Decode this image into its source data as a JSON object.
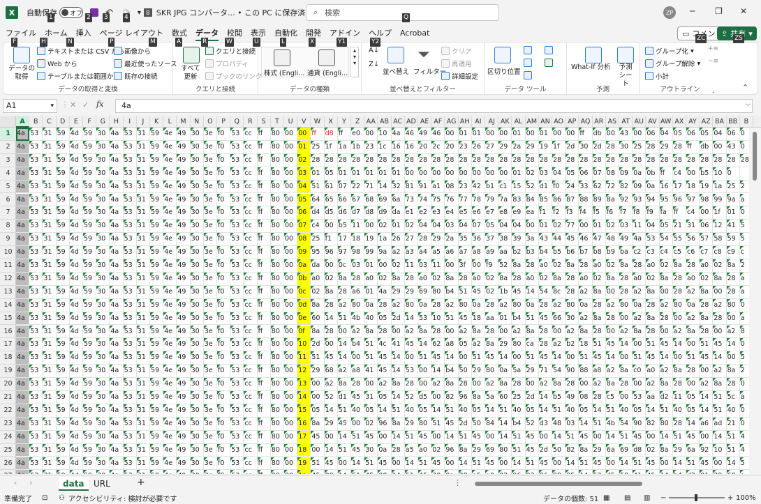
{
  "title_bar": {
    "autosave_label": "自動保存",
    "autosave_state": "オフ",
    "doc_title": "SKR JPG コンバータ... • この PC に保存済み",
    "search_placeholder": "検索",
    "avatar_label": "ZP",
    "keytips": [
      "1",
      "2",
      "3",
      "4",
      "Q"
    ]
  },
  "tabs": [
    {
      "label": "ファイル",
      "key": "F"
    },
    {
      "label": "ホーム",
      "key": "H"
    },
    {
      "label": "挿入",
      "key": "N"
    },
    {
      "label": "ページ レイアウト",
      "key": "P"
    },
    {
      "label": "数式",
      "key": "M"
    },
    {
      "label": "データ",
      "key": "A"
    },
    {
      "label": "校閲",
      "key": "R"
    },
    {
      "label": "表示",
      "key": "W"
    },
    {
      "label": "自動化",
      "key": "U"
    },
    {
      "label": "開発",
      "key": "L"
    },
    {
      "label": "アドイン",
      "key": "X"
    },
    {
      "label": "ヘルプ",
      "key": "Y1"
    },
    {
      "label": "Acrobat",
      "key": "Y2"
    }
  ],
  "comment_button": {
    "label": "コメント",
    "key": "ZC"
  },
  "share_button": {
    "label": "共有",
    "key": "ZS"
  },
  "ribbon": {
    "get_data": {
      "title": "データの取得",
      "items": [
        "テキストまたは CSV から",
        "Web から",
        "テーブルまたは範囲から",
        "画像から",
        "最近使ったソース",
        "既存の接続"
      ],
      "label": "データの取得と変換"
    },
    "queries": {
      "refresh": "すべて更新",
      "items": [
        "クエリと接続",
        "プロパティ",
        "ブックのリンク"
      ],
      "label": "クエリと接続"
    },
    "types": {
      "items": [
        "株式 (Engli...",
        "通貨 (Engli..."
      ],
      "label": "データの種類"
    },
    "sort": {
      "items": [
        "並べ替え",
        "フィルター",
        "クリア",
        "再適用",
        "詳細設定"
      ],
      "label": "並べ替えとフィルター"
    },
    "tools": {
      "items": [
        "区切り位置"
      ],
      "label": "データ ツール"
    },
    "forecast": {
      "items": [
        "What-If 分析",
        "予測シート"
      ],
      "label": "予測"
    },
    "outline": {
      "items": [
        "グループ化",
        "グループ解除",
        "小計"
      ],
      "label": "アウトライン"
    }
  },
  "formula_bar": {
    "cell_ref": "A1",
    "fx": "fx",
    "value": "4a"
  },
  "columns": [
    "A",
    "B",
    "C",
    "D",
    "E",
    "F",
    "G",
    "H",
    "I",
    "J",
    "K",
    "L",
    "M",
    "N",
    "O",
    "P",
    "Q",
    "R",
    "S",
    "T",
    "U",
    "V",
    "W",
    "X",
    "Y",
    "Z",
    "AA",
    "AB",
    "AC",
    "AD",
    "AE",
    "AF",
    "AG",
    "AH",
    "AI",
    "AJ",
    "AK",
    "AL",
    "AM",
    "AN",
    "AO",
    "AP",
    "AQ",
    "AR",
    "AS",
    "AT",
    "AU",
    "AV",
    "AW",
    "AX",
    "AY",
    "AZ",
    "BA",
    "BB",
    "B"
  ],
  "common_prefix": [
    "4a",
    "53",
    "31",
    "59",
    "4d",
    "59",
    "30",
    "4a",
    "53",
    "31",
    "59",
    "4e",
    "49",
    "30",
    "3e",
    "f0",
    "53",
    "cc",
    "ff",
    "80",
    "00"
  ],
  "rows": [
    {
      "num": "1",
      "v": "00",
      "tail": [
        "ff",
        "d8",
        "ff",
        "e0",
        "00",
        "10",
        "4a",
        "46",
        "49",
        "46",
        "00",
        "01",
        "01",
        "00",
        "00",
        "01",
        "00",
        "01",
        "00",
        "00",
        "ff",
        "db",
        "00",
        "43",
        "00",
        "06",
        "04",
        "05",
        "06",
        "05",
        "04",
        "06",
        "0"
      ]
    },
    {
      "num": "2",
      "v": "01",
      "tail": [
        "25",
        "1f",
        "1a",
        "1b",
        "23",
        "1c",
        "16",
        "16",
        "20",
        "2c",
        "20",
        "23",
        "26",
        "27",
        "29",
        "2a",
        "29",
        "19",
        "1f",
        "2d",
        "30",
        "2d",
        "28",
        "30",
        "25",
        "28",
        "29",
        "28",
        "ff",
        "db",
        "00",
        "43",
        "0"
      ]
    },
    {
      "num": "3",
      "v": "02",
      "tail": [
        "28",
        "28",
        "28",
        "28",
        "28",
        "28",
        "28",
        "28",
        "28",
        "28",
        "28",
        "28",
        "28",
        "28",
        "28",
        "28",
        "28",
        "28",
        "28",
        "28",
        "28",
        "28",
        "28",
        "28",
        "28",
        "28",
        "28",
        "28",
        "28",
        "28",
        "28",
        "28",
        "28"
      ]
    },
    {
      "num": "4",
      "v": "03",
      "tail": [
        "01",
        "05",
        "01",
        "01",
        "01",
        "01",
        "01",
        "00",
        "00",
        "00",
        "00",
        "00",
        "00",
        "00",
        "00",
        "01",
        "02",
        "03",
        "04",
        "05",
        "06",
        "07",
        "08",
        "09",
        "0a",
        "0b",
        "ff",
        "c4",
        "00",
        "b5",
        "10",
        "0",
        ""
      ]
    },
    {
      "num": "5",
      "v": "04",
      "tail": [
        "51",
        "61",
        "07",
        "22",
        "71",
        "14",
        "32",
        "81",
        "91",
        "a1",
        "08",
        "23",
        "42",
        "b1",
        "c1",
        "15",
        "52",
        "d1",
        "f0",
        "24",
        "33",
        "62",
        "72",
        "82",
        "09",
        "0a",
        "16",
        "17",
        "18",
        "19",
        "1a",
        "25",
        "2"
      ]
    },
    {
      "num": "6",
      "v": "05",
      "tail": [
        "64",
        "65",
        "66",
        "67",
        "68",
        "69",
        "6a",
        "73",
        "74",
        "75",
        "76",
        "77",
        "78",
        "79",
        "7a",
        "83",
        "84",
        "85",
        "86",
        "87",
        "88",
        "89",
        "8a",
        "92",
        "93",
        "94",
        "95",
        "96",
        "97",
        "98",
        "99",
        "9a",
        "a"
      ]
    },
    {
      "num": "7",
      "v": "06",
      "tail": [
        "d4",
        "d5",
        "d6",
        "d7",
        "d8",
        "d9",
        "da",
        "e1",
        "e2",
        "e3",
        "e4",
        "e5",
        "e6",
        "e7",
        "e8",
        "e9",
        "ea",
        "f1",
        "f2",
        "f3",
        "f4",
        "f5",
        "f6",
        "f7",
        "f8",
        "f9",
        "fa",
        "ff",
        "c4",
        "00",
        "1f",
        "01",
        "0"
      ]
    },
    {
      "num": "8",
      "v": "07",
      "tail": [
        "c4",
        "00",
        "b5",
        "11",
        "00",
        "02",
        "01",
        "02",
        "04",
        "04",
        "03",
        "04",
        "07",
        "05",
        "04",
        "04",
        "00",
        "01",
        "02",
        "77",
        "00",
        "01",
        "02",
        "03",
        "11",
        "04",
        "05",
        "21",
        "31",
        "06",
        "12",
        "41",
        "5"
      ]
    },
    {
      "num": "9",
      "v": "08",
      "tail": [
        "25",
        "f1",
        "17",
        "18",
        "19",
        "1a",
        "26",
        "27",
        "28",
        "29",
        "2a",
        "35",
        "36",
        "37",
        "38",
        "39",
        "3a",
        "43",
        "44",
        "45",
        "46",
        "47",
        "48",
        "49",
        "4a",
        "53",
        "54",
        "55",
        "56",
        "57",
        "58",
        "59",
        "5"
      ]
    },
    {
      "num": "10",
      "v": "09",
      "tail": [
        "95",
        "96",
        "97",
        "98",
        "99",
        "9a",
        "a2",
        "a3",
        "a4",
        "a5",
        "a6",
        "a7",
        "a8",
        "a9",
        "aa",
        "b2",
        "b3",
        "b4",
        "b5",
        "b6",
        "b7",
        "b8",
        "b9",
        "ba",
        "c2",
        "c3",
        "c4",
        "c5",
        "c6",
        "c7",
        "c8",
        "c9",
        "c"
      ]
    },
    {
      "num": "11",
      "v": "0a",
      "tail": [
        "da",
        "00",
        "0c",
        "03",
        "01",
        "00",
        "02",
        "11",
        "03",
        "11",
        "00",
        "3f",
        "00",
        "f9",
        "52",
        "8a",
        "28",
        "a0",
        "02",
        "8a",
        "28",
        "a0",
        "02",
        "8a",
        "28",
        "a0",
        "02",
        "8a",
        "28",
        "a0",
        "02",
        "8a",
        "2"
      ]
    },
    {
      "num": "12",
      "v": "0b",
      "tail": [
        "a0",
        "02",
        "8a",
        "28",
        "a0",
        "02",
        "8a",
        "28",
        "a0",
        "02",
        "8a",
        "28",
        "a0",
        "02",
        "8a",
        "28",
        "a0",
        "02",
        "8a",
        "28",
        "a0",
        "02",
        "8a",
        "28",
        "a0",
        "02",
        "8a",
        "28",
        "a0",
        "02",
        "8a",
        "28",
        "a"
      ]
    },
    {
      "num": "13",
      "v": "0c",
      "tail": [
        "02",
        "8a",
        "28",
        "a6",
        "01",
        "4a",
        "29",
        "29",
        "69",
        "80",
        "b4",
        "51",
        "45",
        "02",
        "1b",
        "45",
        "14",
        "54",
        "8c",
        "28",
        "a2",
        "8a",
        "00",
        "28",
        "a2",
        "8a",
        "00",
        "28",
        "a2",
        "8a",
        "00",
        "28",
        "a"
      ]
    },
    {
      "num": "14",
      "v": "0d",
      "tail": [
        "8a",
        "28",
        "a2",
        "80",
        "0a",
        "28",
        "a2",
        "80",
        "0a",
        "28",
        "a2",
        "80",
        "0a",
        "28",
        "a2",
        "80",
        "0a",
        "28",
        "a2",
        "80",
        "0a",
        "28",
        "a2",
        "80",
        "0a",
        "28",
        "a2",
        "80",
        "0a",
        "28",
        "a2",
        "80",
        "0"
      ]
    },
    {
      "num": "15",
      "v": "0e",
      "tail": [
        "60",
        "14",
        "51",
        "4b",
        "40",
        "05",
        "2d",
        "14",
        "53",
        "10",
        "51",
        "45",
        "18",
        "aa",
        "01",
        "b4",
        "51",
        "45",
        "66",
        "30",
        "a2",
        "8a",
        "28",
        "00",
        "a2",
        "8a",
        "28",
        "00",
        "a2",
        "8a",
        "28",
        "00",
        "a"
      ]
    },
    {
      "num": "16",
      "v": "0f",
      "tail": [
        "8a",
        "28",
        "00",
        "a2",
        "8a",
        "28",
        "00",
        "a2",
        "8a",
        "28",
        "00",
        "a2",
        "8a",
        "28",
        "00",
        "a2",
        "8a",
        "28",
        "00",
        "a2",
        "8a",
        "28",
        "00",
        "a2",
        "8a",
        "28",
        "00",
        "a2",
        "8a",
        "28",
        "00",
        "a2",
        "8"
      ]
    },
    {
      "num": "17",
      "v": "10",
      "tail": [
        "2d",
        "00",
        "14",
        "b4",
        "51",
        "4c",
        "41",
        "45",
        "14",
        "62",
        "a8",
        "05",
        "a2",
        "8a",
        "29",
        "80",
        "ca",
        "28",
        "a2",
        "b2",
        "18",
        "51",
        "45",
        "14",
        "00",
        "51",
        "45",
        "14",
        "00",
        "51",
        "45",
        "14",
        "0"
      ]
    },
    {
      "num": "18",
      "v": "11",
      "tail": [
        "51",
        "45",
        "14",
        "00",
        "51",
        "45",
        "14",
        "00",
        "51",
        "45",
        "14",
        "00",
        "51",
        "45",
        "14",
        "00",
        "51",
        "45",
        "14",
        "00",
        "51",
        "45",
        "14",
        "00",
        "51",
        "45",
        "14",
        "00",
        "51",
        "45",
        "14",
        "00",
        "5"
      ]
    },
    {
      "num": "19",
      "v": "12",
      "tail": [
        "29",
        "68",
        "a2",
        "a8",
        "41",
        "45",
        "14",
        "53",
        "00",
        "14",
        "b4",
        "50",
        "29",
        "80",
        "0a",
        "5a",
        "29",
        "71",
        "54",
        "90",
        "88",
        "a8",
        "a2",
        "8a",
        "c0",
        "a0",
        "a2",
        "8a",
        "28",
        "00",
        "a2",
        "8a",
        "2"
      ]
    },
    {
      "num": "20",
      "v": "13",
      "tail": [
        "00",
        "a2",
        "8a",
        "28",
        "00",
        "a2",
        "8a",
        "28",
        "00",
        "a2",
        "8a",
        "28",
        "00",
        "a2",
        "8a",
        "28",
        "00",
        "a2",
        "8a",
        "28",
        "00",
        "a2",
        "8a",
        "28",
        "00",
        "a2",
        "8a",
        "28",
        "00",
        "a2",
        "8a",
        "28",
        "0"
      ]
    },
    {
      "num": "21",
      "v": "14",
      "tail": [
        "00",
        "52",
        "d1",
        "45",
        "31",
        "05",
        "14",
        "52",
        "d5",
        "00",
        "82",
        "96",
        "8a",
        "5a",
        "60",
        "25",
        "2d",
        "14",
        "b5",
        "49",
        "08",
        "28",
        "c5",
        "00",
        "53",
        "aa",
        "d2",
        "11",
        "05",
        "14",
        "51",
        "5c",
        "a"
      ]
    },
    {
      "num": "22",
      "v": "15",
      "tail": [
        "05",
        "14",
        "51",
        "40",
        "05",
        "14",
        "51",
        "40",
        "05",
        "14",
        "51",
        "40",
        "05",
        "14",
        "51",
        "40",
        "05",
        "14",
        "51",
        "40",
        "05",
        "14",
        "51",
        "40",
        "05",
        "14",
        "51",
        "40",
        "05",
        "14",
        "51",
        "40",
        "0"
      ]
    },
    {
      "num": "23",
      "v": "16",
      "tail": [
        "8a",
        "29",
        "45",
        "00",
        "02",
        "96",
        "8a",
        "29",
        "80",
        "51",
        "45",
        "2d",
        "50",
        "84",
        "14",
        "b4",
        "52",
        "d3",
        "48",
        "03",
        "14",
        "51",
        "4b",
        "54",
        "90",
        "82",
        "80",
        "28",
        "14",
        "a6",
        "ad",
        "21",
        "0"
      ]
    },
    {
      "num": "24",
      "v": "17",
      "tail": [
        "45",
        "00",
        "14",
        "51",
        "45",
        "00",
        "14",
        "51",
        "45",
        "00",
        "14",
        "51",
        "45",
        "00",
        "14",
        "51",
        "45",
        "00",
        "14",
        "51",
        "45",
        "00",
        "14",
        "51",
        "45",
        "00",
        "14",
        "51",
        "45",
        "00",
        "14",
        "51",
        "4"
      ]
    },
    {
      "num": "25",
      "v": "18",
      "tail": [
        "00",
        "14",
        "51",
        "45",
        "30",
        "0a",
        "28",
        "a5",
        "a0",
        "02",
        "96",
        "8a",
        "29",
        "69",
        "80",
        "51",
        "45",
        "2d",
        "50",
        "82",
        "8a",
        "29",
        "6a",
        "69",
        "d8",
        "02",
        "8a",
        "29",
        "6a",
        "92",
        "10",
        "51",
        "4"
      ]
    },
    {
      "num": "26",
      "v": "19",
      "tail": [
        "51",
        "45",
        "00",
        "14",
        "51",
        "45",
        "00",
        "14",
        "51",
        "45",
        "00",
        "14",
        "51",
        "45",
        "00",
        "14",
        "51",
        "45",
        "00",
        "14",
        "51",
        "45",
        "00",
        "14",
        "51",
        "45",
        "00",
        "14",
        "51",
        "45",
        "00",
        "14",
        "5"
      ]
    },
    {
      "num": "27",
      "v": "1a",
      "tail": [
        "45",
        "00",
        "14",
        "51",
        "45",
        "00",
        "14",
        "51",
        "45",
        "30",
        "0a",
        "28",
        "a5",
        "a0",
        "02",
        "96",
        "92",
        "96",
        "98",
        "05",
        "14",
        "52",
        "d5",
        "58",
        "41",
        "45",
        "14",
        "b4",
        "d2",
        "01",
        "29",
        "68",
        "a"
      ]
    },
    {
      "num": "28",
      "v": "1b",
      "tail": [
        "29",
        "d1",
        "45",
        "15",
        "a7",
        "0b",
        "05",
        "14",
        "51",
        "40",
        "05",
        "14",
        "51",
        "40",
        "05",
        "14",
        "51",
        "40",
        "05",
        "14",
        "51",
        "40",
        "05",
        "14",
        "51",
        "40",
        "05",
        "14",
        "51",
        "40",
        "05",
        "14",
        "5"
      ]
    }
  ],
  "sheets": [
    "data",
    "URL"
  ],
  "status": {
    "ready": "準備完了",
    "accessibility": "アクセシビリティ: 検討が必要です",
    "count": "データの個数: 51",
    "zoom": "100%"
  }
}
